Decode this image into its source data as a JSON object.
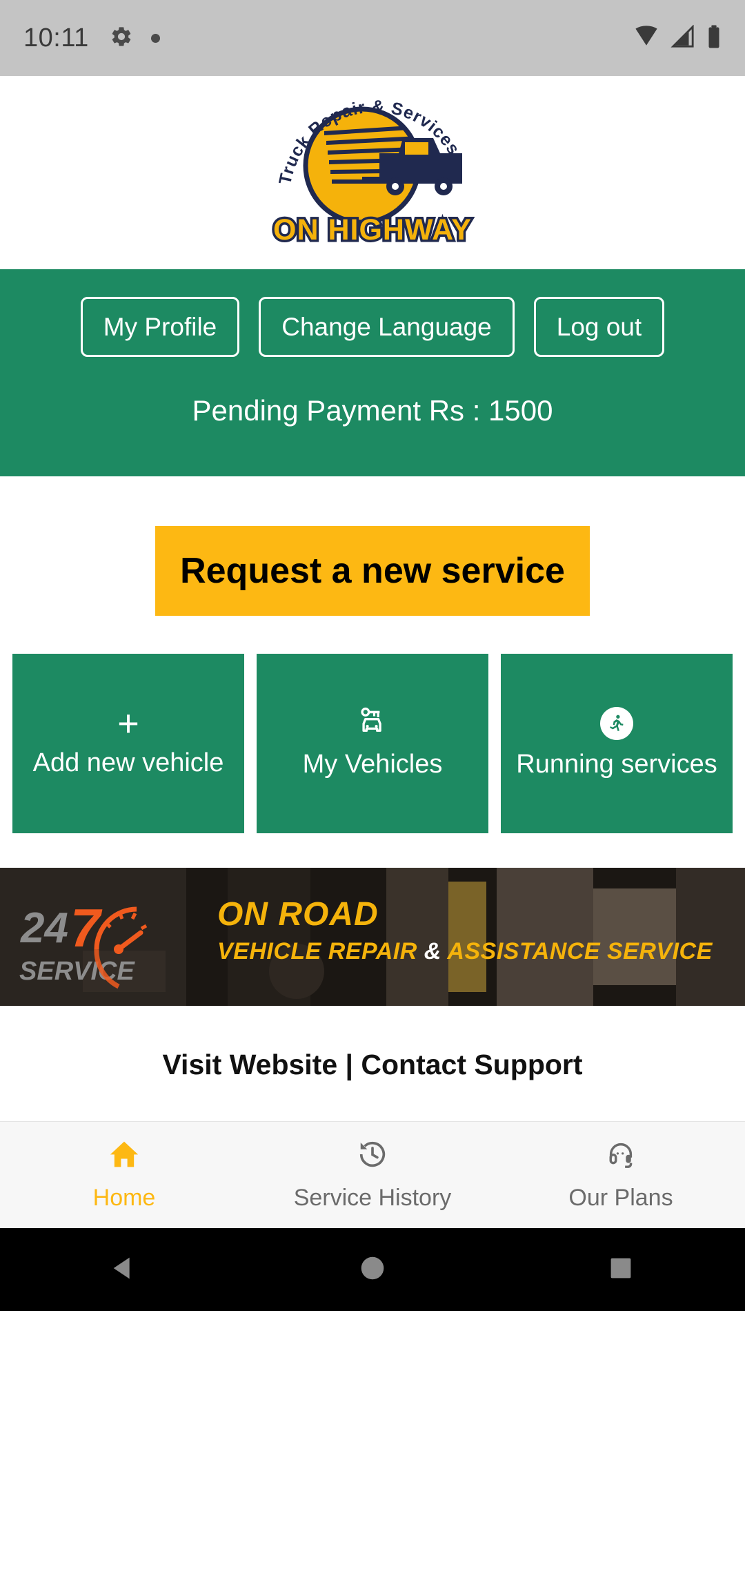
{
  "status_bar": {
    "time": "10:11",
    "left_icons": [
      "gear-icon",
      "dot-icon"
    ],
    "right_icons": [
      "wifi-icon",
      "signal-icon",
      "battery-icon"
    ]
  },
  "logo": {
    "curved_text": "Truck Repair & Services",
    "wordmark": "ON HIGHWAY",
    "colors": {
      "gold": "#FDB813",
      "navy": "#20294F"
    }
  },
  "account_panel": {
    "background": "#1d8a62",
    "buttons": [
      {
        "label": "My Profile"
      },
      {
        "label": "Change Language"
      },
      {
        "label": "Log out"
      }
    ],
    "pending_payment": "Pending Payment Rs : 1500"
  },
  "primary_action": {
    "label": "Request a new service",
    "background": "#FDB813",
    "text_color": "#000000"
  },
  "quick_cards": [
    {
      "icon": "plus-icon",
      "label": "Add new vehicle"
    },
    {
      "icon": "car-key-icon",
      "label": "My Vehicles"
    },
    {
      "icon": "running-person-icon",
      "label": "Running services"
    }
  ],
  "banner": {
    "badge": "24/7 SERVICE",
    "badge_line1": "24",
    "badge_line2": "7",
    "badge_line3": "SERVICE",
    "headline": "ON ROAD",
    "subline_1": "VEHICLE REPAIR ",
    "subline_amp": "&",
    "subline_2": " ASSISTANCE SERVICE"
  },
  "footer_links": {
    "visit": "Visit Website",
    "separator": " | ",
    "support": "Contact Support"
  },
  "bottom_nav": {
    "active_color": "#FDB813",
    "inactive_color": "#6b6b6b",
    "items": [
      {
        "icon": "home-icon",
        "label": "Home",
        "active": true
      },
      {
        "icon": "history-clock-icon",
        "label": "Service History",
        "active": false
      },
      {
        "icon": "headset-support-icon",
        "label": "Our Plans",
        "active": false
      }
    ]
  },
  "android_nav": {
    "buttons": [
      "back-triangle-icon",
      "home-circle-icon",
      "recents-square-icon"
    ]
  }
}
